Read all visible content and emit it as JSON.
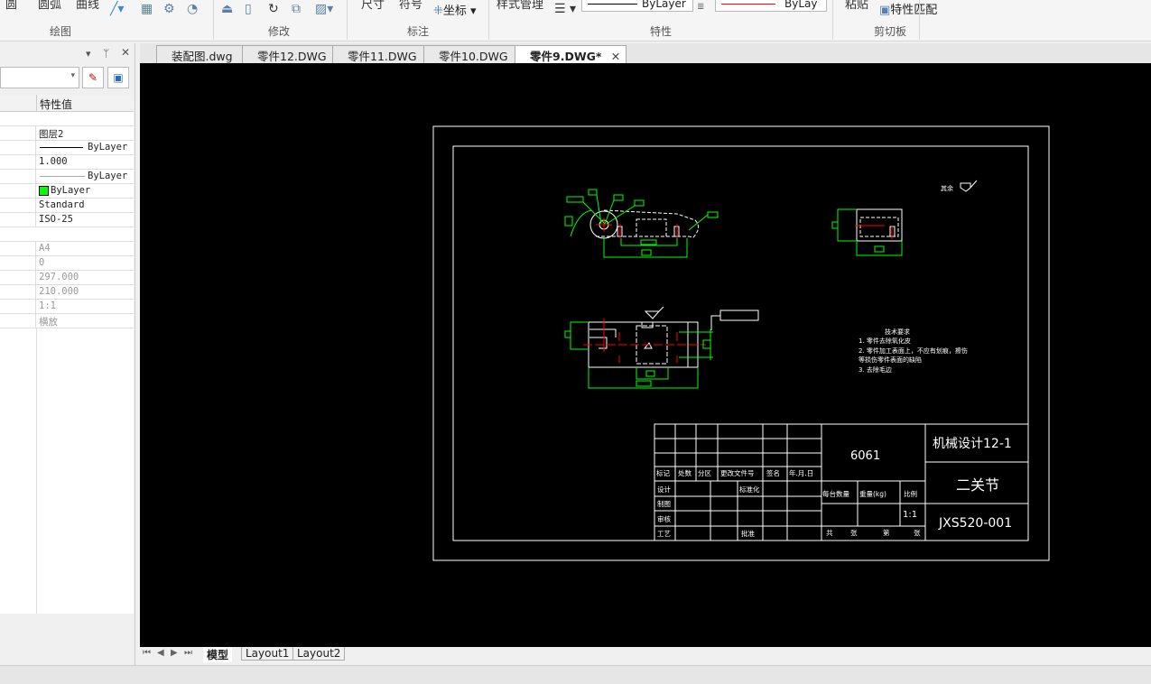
{
  "ribbon": {
    "draw_items": [
      "圆",
      "圆弧",
      "曲线"
    ],
    "annot_items": [
      "尺寸",
      "符号",
      "坐标"
    ],
    "style_mgr": "样式管理",
    "paste": "粘贴",
    "match_props": "特性匹配",
    "linetype_value": "ByLayer",
    "color_value": "ByLayer",
    "groups": {
      "draw": "绘图",
      "modify": "修改",
      "annotate": "标注",
      "properties": "特性",
      "clipboard": "剪切板"
    }
  },
  "file_tabs": [
    {
      "label": "装配图.dwg"
    },
    {
      "label": "零件12.DWG"
    },
    {
      "label": "零件11.DWG"
    },
    {
      "label": "零件10.DWG"
    },
    {
      "label": "零件9.DWG*",
      "active": true
    }
  ],
  "properties_panel": {
    "column_header": "特性值",
    "rows": [
      "图层2",
      "ByLayer",
      "1.000",
      "ByLayer",
      "ByLayer",
      "Standard",
      "ISO-25"
    ],
    "layout_rows": [
      "A4",
      "0",
      "297.000",
      "210.000",
      "1:1",
      "横放"
    ],
    "color_swatch": "#00ff00"
  },
  "drawing": {
    "roughness_label": "其余",
    "tech_req": {
      "title": "技术要求",
      "lines": [
        "1. 零件去除氧化皮",
        "2. 零件加工表面上，不应有划痕，擦伤",
        "等损伤零件表面的缺陷",
        "3. 去除毛边"
      ]
    },
    "title_block": {
      "headers": [
        "标记",
        "处数",
        "分区",
        "更改文件号",
        "签名",
        "年.月.日"
      ],
      "roles": [
        "设计",
        "制图",
        "审核",
        "工艺"
      ],
      "standardization": "标准化",
      "approve": "批准",
      "material": "6061",
      "qty_label": "每台数量",
      "weight_label": "重量(kg)",
      "scale_label": "比例",
      "scale": "1:1",
      "sheets": [
        "共",
        "张",
        "第",
        "张"
      ],
      "project": "机械设计12-1",
      "part_name": "二关节",
      "drawing_no": "JXS520-001"
    }
  },
  "layout_tabs": [
    "模型",
    "Layout1",
    "Layout2"
  ],
  "colors": {
    "geometry": "#ffffff",
    "dimension": "#00ff00",
    "centerline": "#ff0000",
    "background": "#000000"
  }
}
